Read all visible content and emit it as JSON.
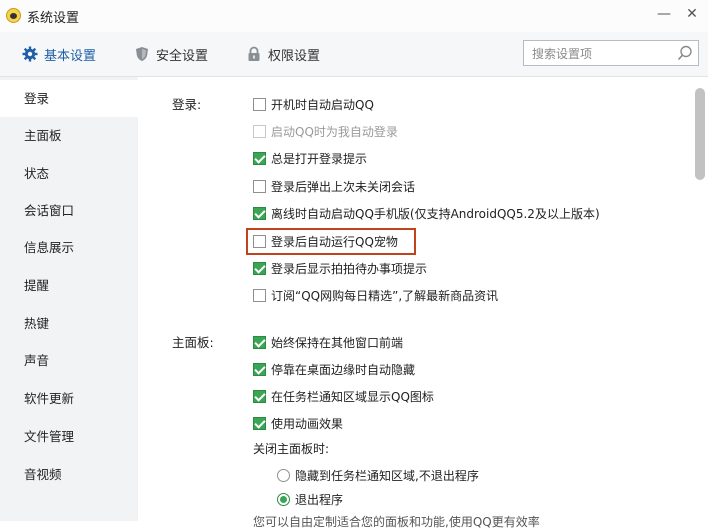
{
  "window": {
    "title": "系统设置",
    "minimize": "—",
    "close": "✕"
  },
  "tabs": [
    {
      "label": "基本设置"
    },
    {
      "label": "安全设置"
    },
    {
      "label": "权限设置"
    }
  ],
  "search": {
    "placeholder": "搜索设置项",
    "value": ""
  },
  "sidebar": {
    "items": [
      {
        "label": "登录"
      },
      {
        "label": "主面板"
      },
      {
        "label": "状态"
      },
      {
        "label": "会话窗口"
      },
      {
        "label": "信息展示"
      },
      {
        "label": "提醒"
      },
      {
        "label": "热键"
      },
      {
        "label": "声音"
      },
      {
        "label": "软件更新"
      },
      {
        "label": "文件管理"
      },
      {
        "label": "音视频"
      }
    ],
    "active_index": 0
  },
  "login_section": {
    "label": "登录:",
    "options": [
      {
        "label": "开机时自动启动QQ",
        "checked": false,
        "disabled": false
      },
      {
        "label": "启动QQ时为我自动登录",
        "checked": false,
        "disabled": true
      },
      {
        "label": "总是打开登录提示",
        "checked": true,
        "disabled": false
      },
      {
        "label": "登录后弹出上次未关闭会话",
        "checked": false,
        "disabled": false
      },
      {
        "label": "离线时自动启动QQ手机版(仅支持AndroidQQ5.2及以上版本)",
        "checked": true,
        "disabled": false
      },
      {
        "label": "登录后自动运行QQ宠物",
        "checked": false,
        "disabled": false
      },
      {
        "label": "登录后显示拍拍待办事项提示",
        "checked": true,
        "disabled": false
      },
      {
        "label": "订阅“QQ网购每日精选”,了解最新商品资讯",
        "checked": false,
        "disabled": false
      }
    ]
  },
  "panel_section": {
    "label": "主面板:",
    "options": [
      {
        "label": "始终保持在其他窗口前端",
        "checked": true
      },
      {
        "label": "停靠在桌面边缘时自动隐藏",
        "checked": true
      },
      {
        "label": "在任务栏通知区域显示QQ图标",
        "checked": true
      },
      {
        "label": "使用动画效果",
        "checked": true
      }
    ],
    "close_label": "关闭主面板时:",
    "close_options": [
      {
        "label": "隐藏到任务栏通知区域,不退出程序",
        "selected": false
      },
      {
        "label": "退出程序",
        "selected": true
      }
    ],
    "footer_text": "您可以自由定制适合您的面板和功能,使用QQ更有效率"
  },
  "colors": {
    "accent": "#1f5fa8",
    "check": "#3aa655",
    "highlight": "#c0431c"
  }
}
